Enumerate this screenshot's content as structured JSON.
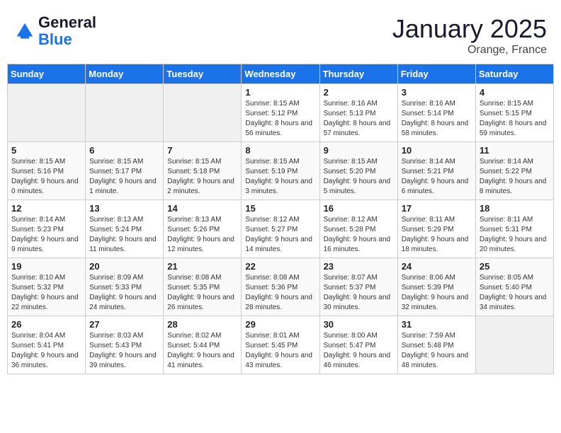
{
  "header": {
    "logo_line1": "General",
    "logo_line2": "Blue",
    "month": "January 2025",
    "location": "Orange, France"
  },
  "weekdays": [
    "Sunday",
    "Monday",
    "Tuesday",
    "Wednesday",
    "Thursday",
    "Friday",
    "Saturday"
  ],
  "weeks": [
    [
      {
        "day": "",
        "sunrise": "",
        "sunset": "",
        "daylight": ""
      },
      {
        "day": "",
        "sunrise": "",
        "sunset": "",
        "daylight": ""
      },
      {
        "day": "",
        "sunrise": "",
        "sunset": "",
        "daylight": ""
      },
      {
        "day": "1",
        "sunrise": "Sunrise: 8:15 AM",
        "sunset": "Sunset: 5:12 PM",
        "daylight": "Daylight: 8 hours and 56 minutes."
      },
      {
        "day": "2",
        "sunrise": "Sunrise: 8:16 AM",
        "sunset": "Sunset: 5:13 PM",
        "daylight": "Daylight: 8 hours and 57 minutes."
      },
      {
        "day": "3",
        "sunrise": "Sunrise: 8:16 AM",
        "sunset": "Sunset: 5:14 PM",
        "daylight": "Daylight: 8 hours and 58 minutes."
      },
      {
        "day": "4",
        "sunrise": "Sunrise: 8:15 AM",
        "sunset": "Sunset: 5:15 PM",
        "daylight": "Daylight: 8 hours and 59 minutes."
      }
    ],
    [
      {
        "day": "5",
        "sunrise": "Sunrise: 8:15 AM",
        "sunset": "Sunset: 5:16 PM",
        "daylight": "Daylight: 9 hours and 0 minutes."
      },
      {
        "day": "6",
        "sunrise": "Sunrise: 8:15 AM",
        "sunset": "Sunset: 5:17 PM",
        "daylight": "Daylight: 9 hours and 1 minute."
      },
      {
        "day": "7",
        "sunrise": "Sunrise: 8:15 AM",
        "sunset": "Sunset: 5:18 PM",
        "daylight": "Daylight: 9 hours and 2 minutes."
      },
      {
        "day": "8",
        "sunrise": "Sunrise: 8:15 AM",
        "sunset": "Sunset: 5:19 PM",
        "daylight": "Daylight: 9 hours and 3 minutes."
      },
      {
        "day": "9",
        "sunrise": "Sunrise: 8:15 AM",
        "sunset": "Sunset: 5:20 PM",
        "daylight": "Daylight: 9 hours and 5 minutes."
      },
      {
        "day": "10",
        "sunrise": "Sunrise: 8:14 AM",
        "sunset": "Sunset: 5:21 PM",
        "daylight": "Daylight: 9 hours and 6 minutes."
      },
      {
        "day": "11",
        "sunrise": "Sunrise: 8:14 AM",
        "sunset": "Sunset: 5:22 PM",
        "daylight": "Daylight: 9 hours and 8 minutes."
      }
    ],
    [
      {
        "day": "12",
        "sunrise": "Sunrise: 8:14 AM",
        "sunset": "Sunset: 5:23 PM",
        "daylight": "Daylight: 9 hours and 9 minutes."
      },
      {
        "day": "13",
        "sunrise": "Sunrise: 8:13 AM",
        "sunset": "Sunset: 5:24 PM",
        "daylight": "Daylight: 9 hours and 11 minutes."
      },
      {
        "day": "14",
        "sunrise": "Sunrise: 8:13 AM",
        "sunset": "Sunset: 5:26 PM",
        "daylight": "Daylight: 9 hours and 12 minutes."
      },
      {
        "day": "15",
        "sunrise": "Sunrise: 8:12 AM",
        "sunset": "Sunset: 5:27 PM",
        "daylight": "Daylight: 9 hours and 14 minutes."
      },
      {
        "day": "16",
        "sunrise": "Sunrise: 8:12 AM",
        "sunset": "Sunset: 5:28 PM",
        "daylight": "Daylight: 9 hours and 16 minutes."
      },
      {
        "day": "17",
        "sunrise": "Sunrise: 8:11 AM",
        "sunset": "Sunset: 5:29 PM",
        "daylight": "Daylight: 9 hours and 18 minutes."
      },
      {
        "day": "18",
        "sunrise": "Sunrise: 8:11 AM",
        "sunset": "Sunset: 5:31 PM",
        "daylight": "Daylight: 9 hours and 20 minutes."
      }
    ],
    [
      {
        "day": "19",
        "sunrise": "Sunrise: 8:10 AM",
        "sunset": "Sunset: 5:32 PM",
        "daylight": "Daylight: 9 hours and 22 minutes."
      },
      {
        "day": "20",
        "sunrise": "Sunrise: 8:09 AM",
        "sunset": "Sunset: 5:33 PM",
        "daylight": "Daylight: 9 hours and 24 minutes."
      },
      {
        "day": "21",
        "sunrise": "Sunrise: 8:08 AM",
        "sunset": "Sunset: 5:35 PM",
        "daylight": "Daylight: 9 hours and 26 minutes."
      },
      {
        "day": "22",
        "sunrise": "Sunrise: 8:08 AM",
        "sunset": "Sunset: 5:36 PM",
        "daylight": "Daylight: 9 hours and 28 minutes."
      },
      {
        "day": "23",
        "sunrise": "Sunrise: 8:07 AM",
        "sunset": "Sunset: 5:37 PM",
        "daylight": "Daylight: 9 hours and 30 minutes."
      },
      {
        "day": "24",
        "sunrise": "Sunrise: 8:06 AM",
        "sunset": "Sunset: 5:39 PM",
        "daylight": "Daylight: 9 hours and 32 minutes."
      },
      {
        "day": "25",
        "sunrise": "Sunrise: 8:05 AM",
        "sunset": "Sunset: 5:40 PM",
        "daylight": "Daylight: 9 hours and 34 minutes."
      }
    ],
    [
      {
        "day": "26",
        "sunrise": "Sunrise: 8:04 AM",
        "sunset": "Sunset: 5:41 PM",
        "daylight": "Daylight: 9 hours and 36 minutes."
      },
      {
        "day": "27",
        "sunrise": "Sunrise: 8:03 AM",
        "sunset": "Sunset: 5:43 PM",
        "daylight": "Daylight: 9 hours and 39 minutes."
      },
      {
        "day": "28",
        "sunrise": "Sunrise: 8:02 AM",
        "sunset": "Sunset: 5:44 PM",
        "daylight": "Daylight: 9 hours and 41 minutes."
      },
      {
        "day": "29",
        "sunrise": "Sunrise: 8:01 AM",
        "sunset": "Sunset: 5:45 PM",
        "daylight": "Daylight: 9 hours and 43 minutes."
      },
      {
        "day": "30",
        "sunrise": "Sunrise: 8:00 AM",
        "sunset": "Sunset: 5:47 PM",
        "daylight": "Daylight: 9 hours and 46 minutes."
      },
      {
        "day": "31",
        "sunrise": "Sunrise: 7:59 AM",
        "sunset": "Sunset: 5:48 PM",
        "daylight": "Daylight: 9 hours and 48 minutes."
      },
      {
        "day": "",
        "sunrise": "",
        "sunset": "",
        "daylight": ""
      }
    ]
  ]
}
